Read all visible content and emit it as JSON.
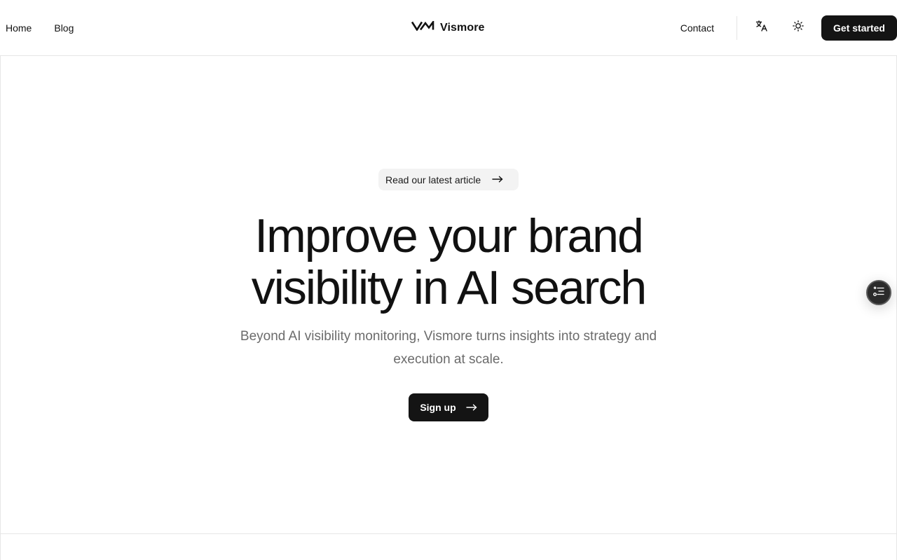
{
  "header": {
    "nav_left": [
      {
        "label": "Home"
      },
      {
        "label": "Blog"
      }
    ],
    "brand": {
      "name": "Vismore",
      "logo_icon": "vm-logo-icon"
    },
    "contact_label": "Contact",
    "translate_icon": "translate-icon",
    "theme_icon": "sun-icon",
    "cta_label": "Get started"
  },
  "hero": {
    "pill_label": "Read our latest article",
    "pill_icon": "arrow-right-icon",
    "title_line1": "Improve your brand",
    "title_line2": "visibility in AI search",
    "subtitle": "Beyond AI visibility monitoring, Vismore turns insights into strategy and execution at scale.",
    "signup_label": "Sign up"
  },
  "floating": {
    "icon": "list-settings-icon"
  },
  "colors": {
    "primary_dark": "#141414",
    "pill_bg": "#f3f3f3",
    "muted_text": "#6b6b6b",
    "border": "#e6e6e6"
  }
}
